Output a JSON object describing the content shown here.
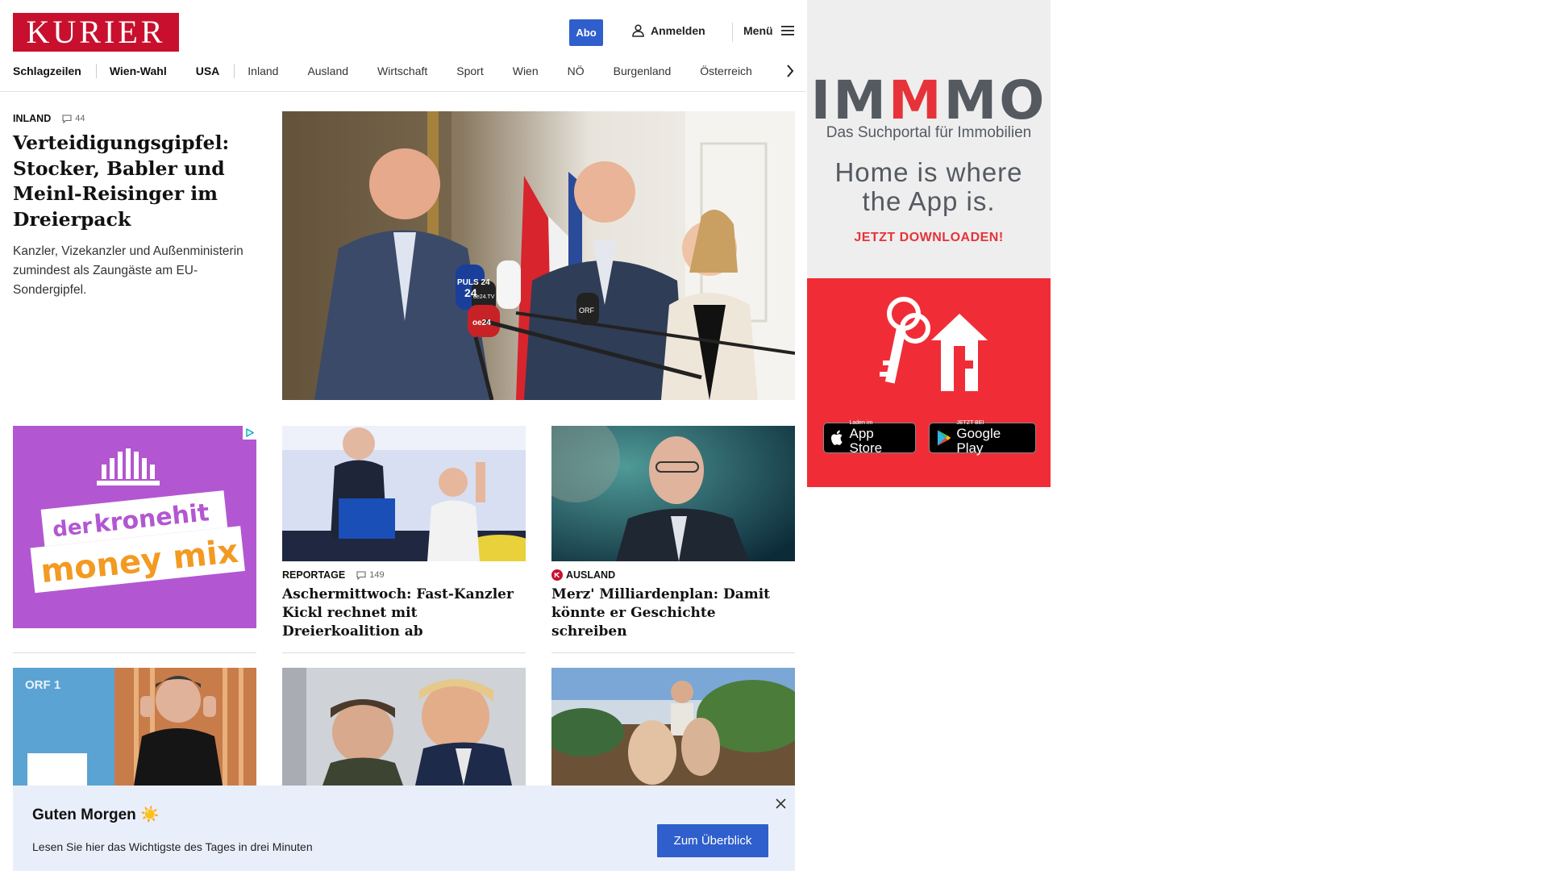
{
  "header": {
    "logo": "KURIER",
    "abo_label": "Abo",
    "login_label": "Anmelden",
    "menu_label": "Menü"
  },
  "nav": {
    "items": [
      "Schlagzeilen",
      "Wien-Wahl",
      "USA",
      "Inland",
      "Ausland",
      "Wirtschaft",
      "Sport",
      "Wien",
      "NÖ",
      "Burgenland",
      "Österreich"
    ]
  },
  "hero": {
    "category": "INLAND",
    "comments": "44",
    "title": "Verteidigungsgipfel: Stocker, Babler und Meinl-Reisinger im Dreierpack",
    "subtitle": "Kanzler, Vizekanzler und Außenministerin zumindest als Zaungäste am EU-Sondergipfel.",
    "mic_labels": [
      "PULS 24",
      "24",
      "oe24.TV",
      "oe24",
      "ORF"
    ]
  },
  "ad_left": {
    "brand_line1": "der",
    "brand_line2": "kronehit",
    "brand_line3": "money mix"
  },
  "cards": [
    {
      "category": "REPORTAGE",
      "comments": "149",
      "title": "Aschermittwoch: Fast-Kanzler Kickl rechnet mit Dreierkoalition ab",
      "has_badge": false
    },
    {
      "category": "AUSLAND",
      "comments": "",
      "title": "Merz' Milliardenplan: Damit könnte er Geschichte schreiben",
      "has_badge": true
    }
  ],
  "row3": {
    "first_label": "ORF 1"
  },
  "banner": {
    "title": "Guten Morgen ☀️",
    "text": "Lesen Sie hier das Wichtigste des Tages in drei Minuten",
    "button": "Zum Überblick"
  },
  "ad_right": {
    "logo_part1": "IM",
    "logo_red": "M",
    "logo_part2": "MO",
    "tagline": "Das Suchportal für Immobilien",
    "slogan_line1": "Home is where",
    "slogan_line2": "the App is.",
    "cta": "JETZT DOWNLOADEN!",
    "appstore_small": "Laden im",
    "appstore_big": "App Store",
    "googleplay_small": "JETZT BEI",
    "googleplay_big": "Google Play"
  },
  "colors": {
    "brand_red": "#c8102e",
    "accent_blue": "#2f5fcc",
    "banner_bg": "#e9effa",
    "immmo_red": "#f02d36"
  }
}
